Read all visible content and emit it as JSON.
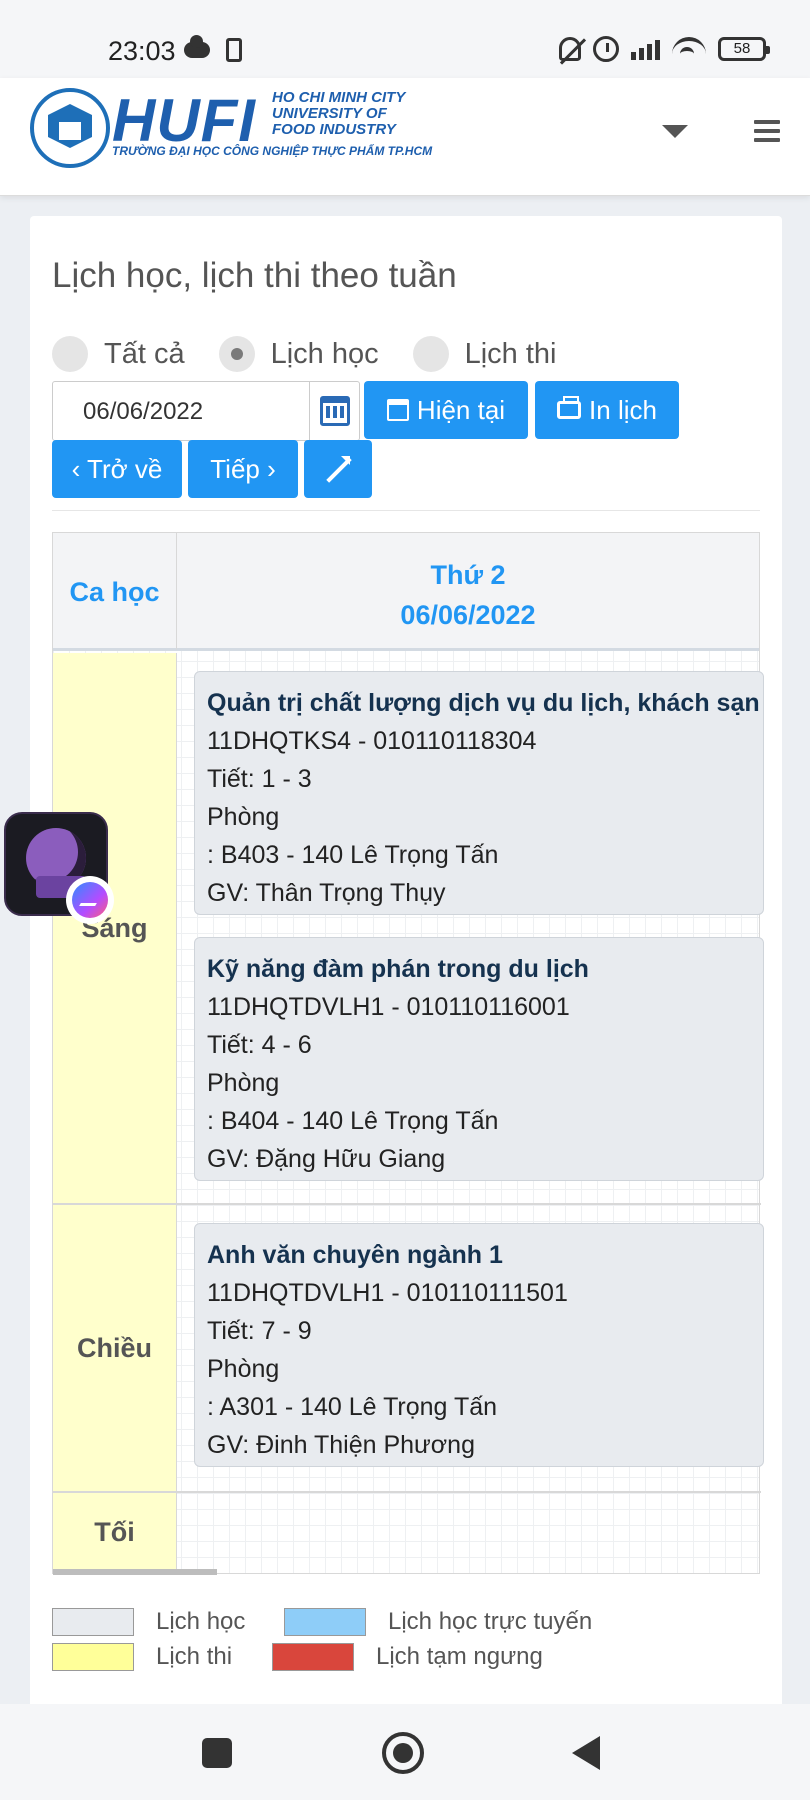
{
  "status_bar": {
    "time": "23:03",
    "battery": "58"
  },
  "header": {
    "logo_text": "HUFI",
    "logo_en_line1": "HO CHI MINH CITY",
    "logo_en_line2": "UNIVERSITY OF",
    "logo_en_line3": "FOOD INDUSTRY",
    "logo_vn": "TRƯỜNG ĐẠI HỌC CÔNG NGHIỆP THỰC PHẨM TP.HCM"
  },
  "page": {
    "title": "Lịch học, lịch thi theo tuần",
    "filters": [
      {
        "label": "Tất cả",
        "selected": false
      },
      {
        "label": "Lịch học",
        "selected": true
      },
      {
        "label": "Lịch thi",
        "selected": false
      }
    ],
    "date_value": "06/06/2022",
    "buttons": {
      "current": "Hiện tại",
      "print": "In lịch",
      "back": "‹ Trở về",
      "next": "Tiếp ›"
    }
  },
  "schedule": {
    "col_session": "Ca học",
    "day_name": "Thứ 2",
    "day_date": "06/06/2022",
    "sessions": {
      "morning": "Sáng",
      "afternoon": "Chiều",
      "evening": "Tối"
    },
    "courses": [
      {
        "name": "Quản trị chất lượng dịch vụ du lịch, khách sạn",
        "code": "11DHQTKS4 - 010110118304",
        "periods": "Tiết: 1 - 3",
        "room_label": "Phòng",
        "room": ": B403 - 140 Lê Trọng Tấn",
        "teacher": "GV: Thân Trọng Thụy"
      },
      {
        "name": "Kỹ năng đàm phán trong du lịch",
        "code": "11DHQTDVLH1 - 010110116001",
        "periods": "Tiết: 4 - 6",
        "room_label": "Phòng",
        "room": ": B404 - 140 Lê Trọng Tấn",
        "teacher": "GV: Đặng Hữu Giang"
      },
      {
        "name": "Anh văn chuyên ngành 1",
        "code": "11DHQTDVLH1 - 010110111501",
        "periods": "Tiết: 7 - 9",
        "room_label": "Phòng",
        "room": ": A301 - 140 Lê Trọng Tấn",
        "teacher": "GV: Đinh Thiện Phương"
      }
    ]
  },
  "legend": [
    {
      "label": "Lịch học",
      "color": "#e8ebef"
    },
    {
      "label": "Lịch học trực tuyến",
      "color": "#8ecdf8"
    },
    {
      "label": "Lịch thi",
      "color": "#ffff99"
    },
    {
      "label": "Lịch tạm ngưng",
      "color": "#d9463c"
    }
  ],
  "colors": {
    "accent": "#2196f3",
    "brand": "#1e5fae",
    "session_bg": "#ffffcc"
  }
}
